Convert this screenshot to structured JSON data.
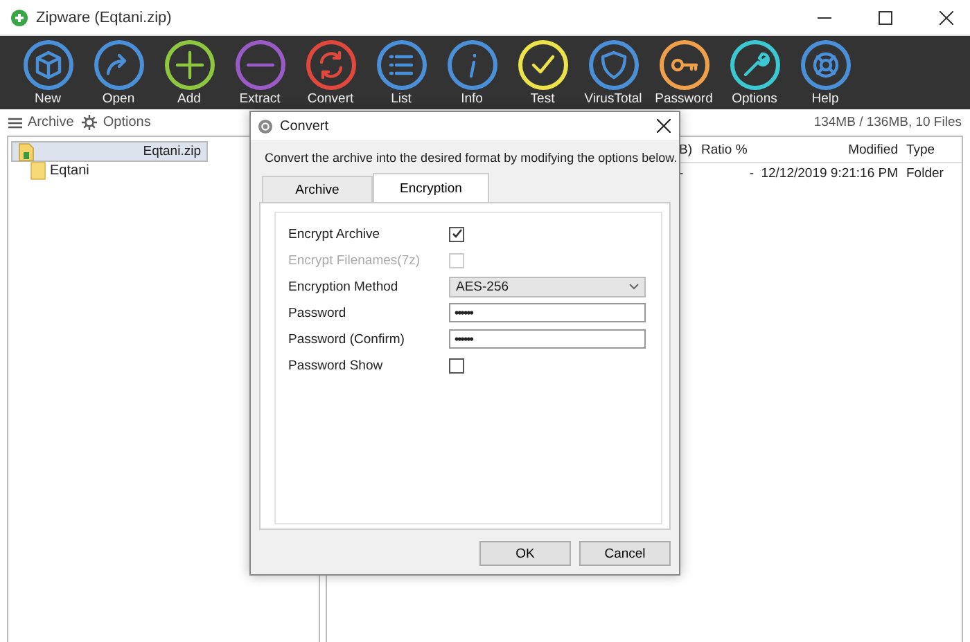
{
  "window": {
    "title": "Zipware (Eqtani.zip)"
  },
  "toolbar": [
    {
      "label": "New",
      "color": "#4a90d9"
    },
    {
      "label": "Open",
      "color": "#4a90d9"
    },
    {
      "label": "Add",
      "color": "#8dc63f"
    },
    {
      "label": "Extract",
      "color": "#9b5bc6"
    },
    {
      "label": "Convert",
      "color": "#e0483e"
    },
    {
      "label": "List",
      "color": "#4a90d9"
    },
    {
      "label": "Info",
      "color": "#4a90d9"
    },
    {
      "label": "Test",
      "color": "#ece24a"
    },
    {
      "label": "VirusTotal",
      "color": "#4a90d9"
    },
    {
      "label": "Password",
      "color": "#f0a04a"
    },
    {
      "label": "Options",
      "color": "#3cc8d0"
    },
    {
      "label": "Help",
      "color": "#4a90d9"
    }
  ],
  "menu": [
    {
      "label": "Archive"
    },
    {
      "label": "Options"
    }
  ],
  "status": "134MB / 136MB, 10 Files",
  "tree": [
    {
      "label": "Eqtani.zip",
      "selected": true,
      "children": [
        {
          "label": "Eqtani",
          "selected": false
        }
      ]
    }
  ],
  "table": {
    "columns": [
      "B)",
      "Ratio %",
      "Modified",
      "Type"
    ],
    "rows": [
      [
        "-",
        "-",
        "12/12/2019 9:21:16 PM",
        "Folder"
      ]
    ]
  },
  "dialog": {
    "title": "Convert",
    "description": "Convert the archive into the desired format by modifying the options below.",
    "tabs": [
      {
        "label": "Archive",
        "selected": false
      },
      {
        "label": "Encryption",
        "selected": true
      }
    ],
    "rows": [
      {
        "kind": "checkbox",
        "label": "Encrypt Archive",
        "checked": true,
        "disabled": false
      },
      {
        "kind": "checkbox",
        "label": "Encrypt Filenames(7z)",
        "checked": false,
        "disabled": true
      },
      {
        "kind": "select",
        "label": "Encryption Method",
        "value": "AES-256"
      },
      {
        "kind": "password",
        "label": "Password",
        "value": "••••••"
      },
      {
        "kind": "password",
        "label": "Password (Confirm)",
        "value": "••••••"
      },
      {
        "kind": "checkbox",
        "label": "Password Show",
        "checked": false,
        "disabled": false
      }
    ],
    "buttons": [
      "OK",
      "Cancel"
    ]
  }
}
